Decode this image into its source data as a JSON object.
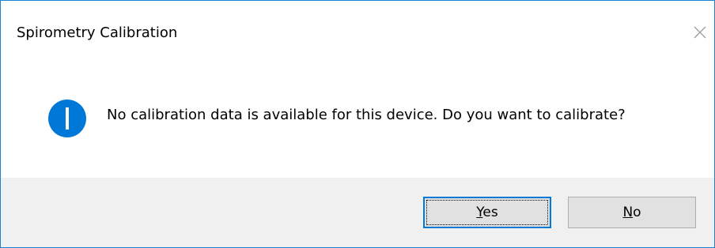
{
  "dialog": {
    "title": "Spirometry Calibration",
    "message": "No calibration data is available for this device. Do you want to calibrate?",
    "icon": "info-icon",
    "accent_color": "#0078d7",
    "buttons": {
      "yes": {
        "mnemonic": "Y",
        "rest": "es"
      },
      "no": {
        "mnemonic": "N",
        "rest": "o"
      }
    }
  }
}
